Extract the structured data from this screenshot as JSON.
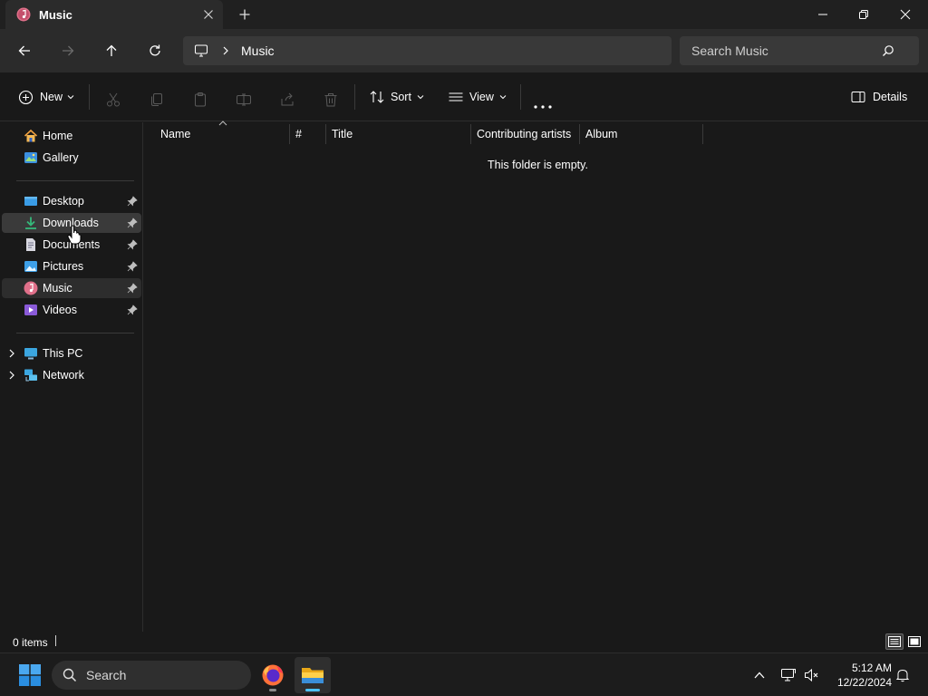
{
  "window": {
    "tab_title": "Music",
    "tab_icon": "music-icon",
    "new_tab_icon": "plus-icon",
    "close_tab_icon": "close-icon",
    "controls": [
      "minimize-icon",
      "restore-icon",
      "close-icon"
    ]
  },
  "navigation": {
    "back_icon": "arrow-left-icon",
    "forward_icon": "arrow-right-icon",
    "up_icon": "arrow-up-icon",
    "refresh_icon": "refresh-icon",
    "breadcrumb": [
      "Music"
    ],
    "search_placeholder": "Search Music"
  },
  "command_bar": {
    "new_label": "New",
    "sort_label": "Sort",
    "view_label": "View",
    "details_label": "Details",
    "disabled_actions": [
      "cut-icon",
      "copy-icon",
      "paste-icon",
      "rename-icon",
      "share-icon",
      "delete-icon"
    ]
  },
  "sidebar": {
    "quick": [
      {
        "label": "Home",
        "icon": "home-icon"
      },
      {
        "label": "Gallery",
        "icon": "gallery-icon"
      }
    ],
    "pinned": [
      {
        "label": "Desktop",
        "icon": "desktop-folder-icon"
      },
      {
        "label": "Downloads",
        "icon": "downloads-folder-icon"
      },
      {
        "label": "Documents",
        "icon": "documents-folder-icon"
      },
      {
        "label": "Pictures",
        "icon": "pictures-folder-icon"
      },
      {
        "label": "Music",
        "icon": "music-folder-icon"
      },
      {
        "label": "Videos",
        "icon": "videos-folder-icon"
      }
    ],
    "devices": [
      {
        "label": "This PC",
        "icon": "this-pc-icon"
      },
      {
        "label": "Network",
        "icon": "network-icon"
      }
    ],
    "selected": "Music",
    "hovered": "Downloads"
  },
  "file_list": {
    "columns": [
      "Name",
      "#",
      "Title",
      "Contributing artists",
      "Album"
    ],
    "empty_message": "This folder is empty."
  },
  "status_bar": {
    "item_count": "0 items"
  },
  "taskbar": {
    "search_label": "Search",
    "apps": [
      "firefox-icon",
      "file-explorer-icon"
    ],
    "time": "5:12 AM",
    "date": "12/22/2024"
  },
  "colors": {
    "accent": "#4cc2ff",
    "background": "#191919",
    "toolbar": "#2b2b2b"
  }
}
